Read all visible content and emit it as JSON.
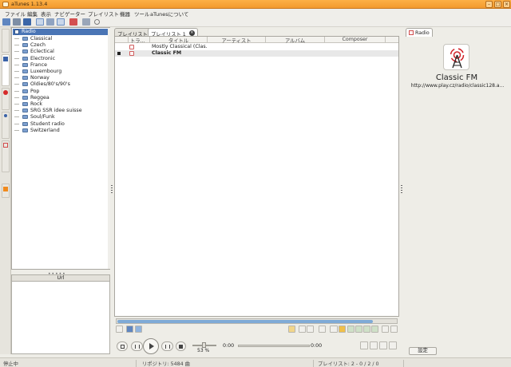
{
  "window": {
    "title": "aTunes 1.13.4"
  },
  "menu": [
    "ファイル",
    "編集",
    "表示",
    "ナビゲーター",
    "プレイリスト",
    "機器",
    "ツール",
    "aTunesについて"
  ],
  "tree": {
    "root": "Radio",
    "items": [
      "Classical",
      "Czech",
      "Eclectical",
      "Electronic",
      "France",
      "Luxembourg",
      "Norway",
      "Oldies/80's/90's",
      "Pop",
      "Reggea",
      "Rock",
      "SRG SSR idee suisse",
      "Soul/Funk",
      "Student radio",
      "Switzerland"
    ]
  },
  "url_panel": {
    "header": "Url"
  },
  "playlist_tabs": {
    "tab1": "プレイリスト",
    "tab2": "プレイリスト 1"
  },
  "table": {
    "columns": [
      "トラ...",
      "タイトル",
      "アーティスト",
      "アルバム",
      "Composer"
    ],
    "rows": [
      {
        "title": "Mostly Classical (Clas..."
      },
      {
        "title": "Classic FM"
      }
    ]
  },
  "player": {
    "volume": "53 %",
    "elapsed": "0:00",
    "remaining": "0:00"
  },
  "radio_panel": {
    "tab": "Radio",
    "station": "Classic FM",
    "url": "http://www.play.cz/radio/classic128.a...",
    "settings_button": "設定"
  },
  "status": {
    "left": "停止中",
    "repository": "リポジトリ: 5484 曲",
    "playlist": "プレイリスト: 2 - 0 / 2 / 0"
  },
  "colors": {
    "titlebar": "#f29a2e",
    "selection": "#4a75b5",
    "scroll": "#7faad6"
  }
}
